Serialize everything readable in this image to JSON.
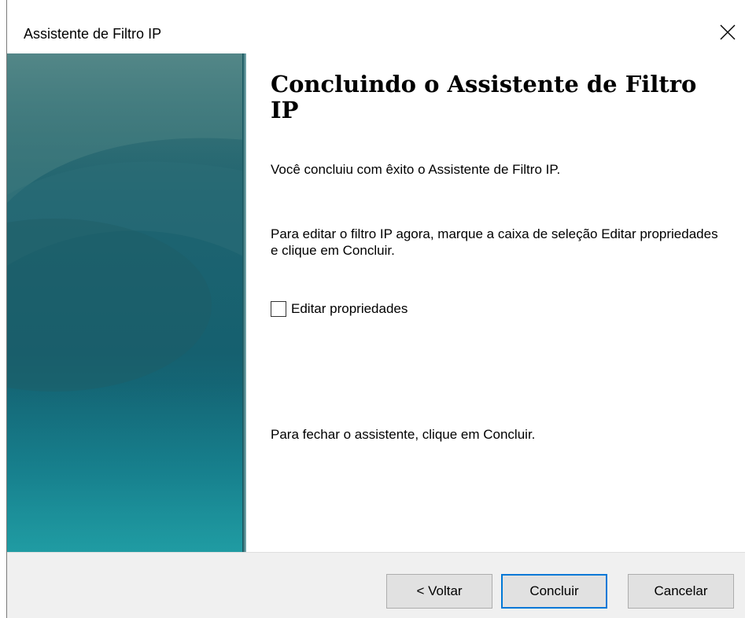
{
  "window": {
    "title": "Assistente de Filtro IP"
  },
  "content": {
    "heading": "Concluindo o Assistente de Filtro IP",
    "paragraph_success": "Você concluiu com êxito o Assistente de Filtro IP.",
    "paragraph_edit_hint": "Para editar o filtro IP agora, marque a caixa de seleção Editar propriedades e clique em Concluir.",
    "checkbox": {
      "label": "Editar propriedades",
      "checked": false
    },
    "paragraph_close_hint": "Para fechar o assistente, clique em Concluir."
  },
  "buttons": {
    "back": "< Voltar",
    "finish": "Concluir",
    "cancel": "Cancelar"
  },
  "icons": {
    "close": "close-icon"
  },
  "colors": {
    "side_panel": "#15606f",
    "primary_button_border": "#0078d7",
    "footer_background": "#f0f0f0"
  }
}
